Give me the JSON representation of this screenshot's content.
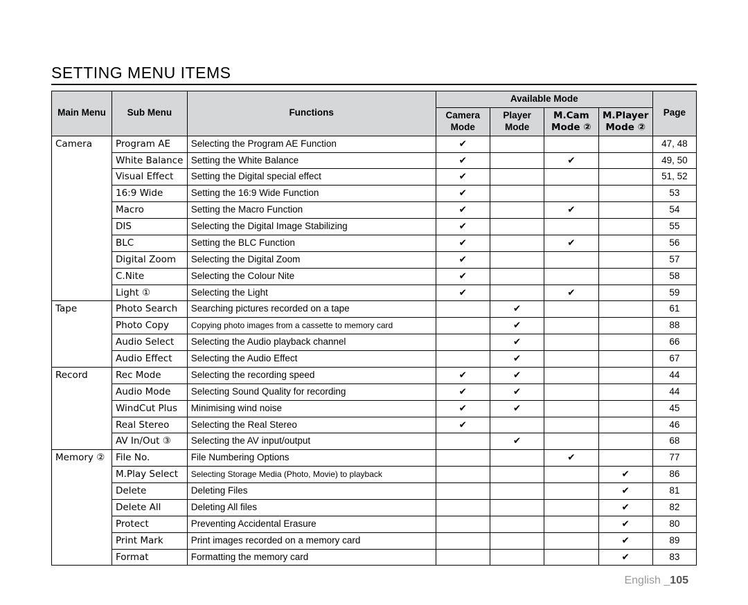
{
  "title": "SETTING MENU ITEMS",
  "header": {
    "main_menu": "Main Menu",
    "sub_menu": "Sub Menu",
    "functions": "Functions",
    "available_mode": "Available Mode",
    "camera_mode": "Camera Mode",
    "player_mode": "Player Mode",
    "mcam_mode": "M.Cam Mode ②",
    "mplayer_mode": "M.Player Mode ②",
    "page": "Page"
  },
  "check": "✔",
  "groups": [
    {
      "main": "Camera",
      "rows": [
        {
          "sub": "Program AE",
          "func": "Selecting the Program AE Function",
          "cam": true,
          "play": false,
          "mcam": false,
          "mplay": false,
          "page": "47, 48"
        },
        {
          "sub": "White Balance",
          "func": "Setting the White Balance",
          "cam": true,
          "play": false,
          "mcam": true,
          "mplay": false,
          "page": "49, 50"
        },
        {
          "sub": "Visual Effect",
          "func": "Setting the Digital special effect",
          "cam": true,
          "play": false,
          "mcam": false,
          "mplay": false,
          "page": "51, 52"
        },
        {
          "sub": "16:9 Wide",
          "func": "Setting the 16:9 Wide Function",
          "cam": true,
          "play": false,
          "mcam": false,
          "mplay": false,
          "page": "53"
        },
        {
          "sub": "Macro",
          "func": "Setting the Macro Function",
          "cam": true,
          "play": false,
          "mcam": true,
          "mplay": false,
          "page": "54"
        },
        {
          "sub": "DIS",
          "func": "Selecting the Digital Image Stabilizing",
          "cam": true,
          "play": false,
          "mcam": false,
          "mplay": false,
          "page": "55"
        },
        {
          "sub": "BLC",
          "func": "Setting the BLC Function",
          "cam": true,
          "play": false,
          "mcam": true,
          "mplay": false,
          "page": "56"
        },
        {
          "sub": "Digital Zoom",
          "func": "Selecting the Digital Zoom",
          "cam": true,
          "play": false,
          "mcam": false,
          "mplay": false,
          "page": "57"
        },
        {
          "sub": "C.Nite",
          "func": "Selecting the Colour Nite",
          "cam": true,
          "play": false,
          "mcam": false,
          "mplay": false,
          "page": "58"
        },
        {
          "sub": "Light ①",
          "func": "Selecting the Light",
          "cam": true,
          "play": false,
          "mcam": true,
          "mplay": false,
          "page": "59"
        }
      ]
    },
    {
      "main": "Tape",
      "rows": [
        {
          "sub": "Photo Search",
          "func": "Searching pictures recorded on a tape",
          "cam": false,
          "play": true,
          "mcam": false,
          "mplay": false,
          "page": "61"
        },
        {
          "sub": "Photo Copy",
          "func": "Copying photo images from a cassette to memory card",
          "func_small": true,
          "cam": false,
          "play": true,
          "mcam": false,
          "mplay": false,
          "page": "88"
        },
        {
          "sub": "Audio Select",
          "func": "Selecting the Audio playback channel",
          "cam": false,
          "play": true,
          "mcam": false,
          "mplay": false,
          "page": "66"
        },
        {
          "sub": "Audio Effect",
          "func": "Selecting the Audio Effect",
          "cam": false,
          "play": true,
          "mcam": false,
          "mplay": false,
          "page": "67"
        }
      ]
    },
    {
      "main": "Record",
      "rows": [
        {
          "sub": "Rec Mode",
          "func": "Selecting the recording speed",
          "cam": true,
          "play": true,
          "mcam": false,
          "mplay": false,
          "page": "44"
        },
        {
          "sub": "Audio Mode",
          "func": "Selecting Sound Quality for recording",
          "cam": true,
          "play": true,
          "mcam": false,
          "mplay": false,
          "page": "44"
        },
        {
          "sub": "WindCut Plus",
          "func": "Minimising wind noise",
          "cam": true,
          "play": true,
          "mcam": false,
          "mplay": false,
          "page": "45"
        },
        {
          "sub": "Real Stereo",
          "func": "Selecting the Real Stereo",
          "cam": true,
          "play": false,
          "mcam": false,
          "mplay": false,
          "page": "46"
        },
        {
          "sub": "AV In/Out ③",
          "func": "Selecting the AV input/output",
          "cam": false,
          "play": true,
          "mcam": false,
          "mplay": false,
          "page": "68"
        }
      ]
    },
    {
      "main": "Memory ②",
      "rows": [
        {
          "sub": "File No.",
          "func": "File Numbering Options",
          "cam": false,
          "play": false,
          "mcam": true,
          "mplay": false,
          "page": "77"
        },
        {
          "sub": "M.Play Select",
          "func": "Selecting Storage Media (Photo, Movie) to playback",
          "func_small": true,
          "cam": false,
          "play": false,
          "mcam": false,
          "mplay": true,
          "page": "86"
        },
        {
          "sub": "Delete",
          "func": "Deleting Files",
          "cam": false,
          "play": false,
          "mcam": false,
          "mplay": true,
          "page": "81"
        },
        {
          "sub": "Delete All",
          "func": "Deleting All files",
          "cam": false,
          "play": false,
          "mcam": false,
          "mplay": true,
          "page": "82"
        },
        {
          "sub": "Protect",
          "func": "Preventing Accidental Erasure",
          "cam": false,
          "play": false,
          "mcam": false,
          "mplay": true,
          "page": "80"
        },
        {
          "sub": "Print Mark",
          "func": "Print images recorded on a memory card",
          "cam": false,
          "play": false,
          "mcam": false,
          "mplay": true,
          "page": "89"
        },
        {
          "sub": "Format",
          "func": "Formatting the memory card",
          "cam": false,
          "play": false,
          "mcam": false,
          "mplay": true,
          "page": "83"
        }
      ]
    }
  ],
  "footer": {
    "language": "English",
    "page_num": "105",
    "sep": " _"
  }
}
